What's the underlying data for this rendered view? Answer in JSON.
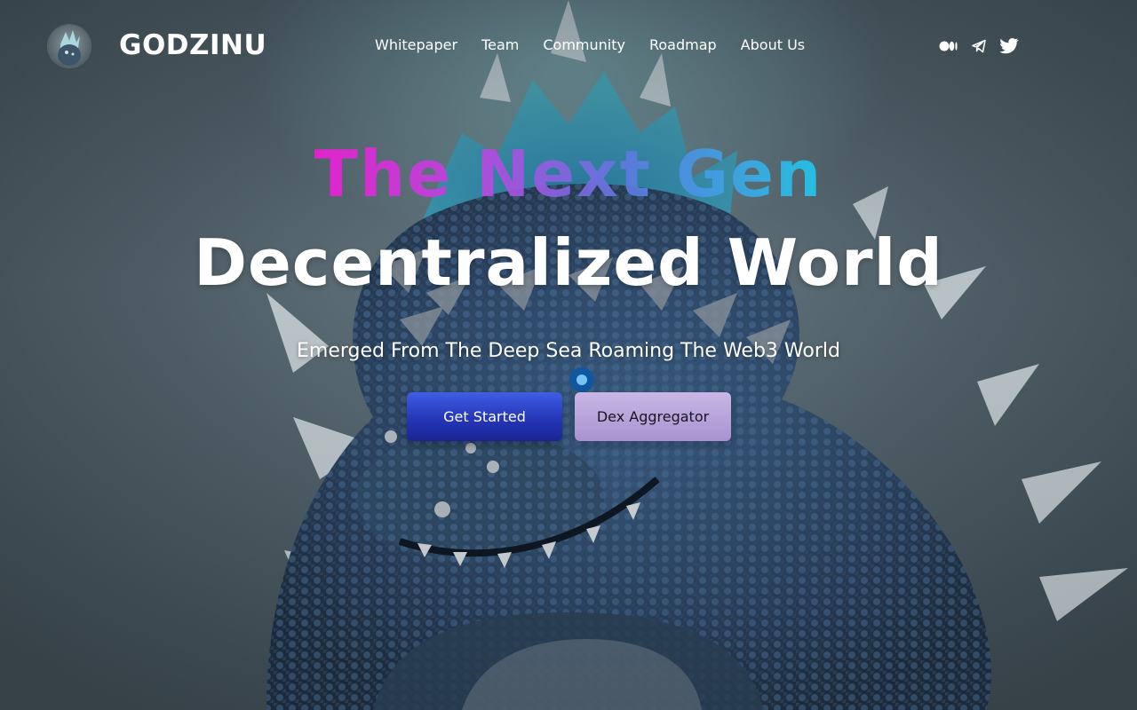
{
  "header": {
    "brand": "GODZINU",
    "nav": [
      {
        "label": "Whitepaper"
      },
      {
        "label": "Team"
      },
      {
        "label": "Community"
      },
      {
        "label": "Roadmap"
      },
      {
        "label": "About Us"
      }
    ],
    "social": [
      {
        "icon": "medium-icon"
      },
      {
        "icon": "telegram-icon"
      },
      {
        "icon": "twitter-icon"
      }
    ]
  },
  "hero": {
    "headline_gradient": "The Next Gen",
    "headline": "Decentralized World",
    "subtitle": "Emerged From The Deep Sea Roaming The Web3 World",
    "primary_button": "Get Started",
    "secondary_button": "Dex Aggregator"
  },
  "colors": {
    "gradient_start": "#ee1fd6",
    "gradient_end": "#21c9ea",
    "primary_button": "#2536b8",
    "secondary_button": "#b3a0d8"
  }
}
